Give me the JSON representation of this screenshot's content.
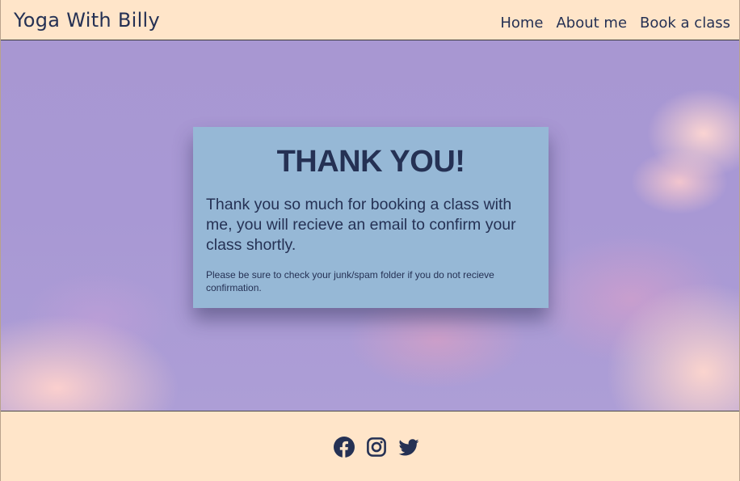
{
  "header": {
    "brand": "Yoga With Billy",
    "nav": [
      {
        "label": "Home"
      },
      {
        "label": "About me"
      },
      {
        "label": "Book a class"
      }
    ]
  },
  "card": {
    "title": "THANK YOU!",
    "message": "Thank you so much for booking a class with me, you will recieve an email to confirm your class shortly.",
    "note": "Please be sure to check your junk/spam folder if you do not recieve confirmation."
  },
  "footer": {
    "social_icons": [
      "facebook-icon",
      "instagram-icon",
      "twitter-icon"
    ]
  },
  "colors": {
    "header_bg": "#ffe5c9",
    "text": "#253154",
    "card_bg": "#96b8d6",
    "sky": "#a897d2"
  }
}
